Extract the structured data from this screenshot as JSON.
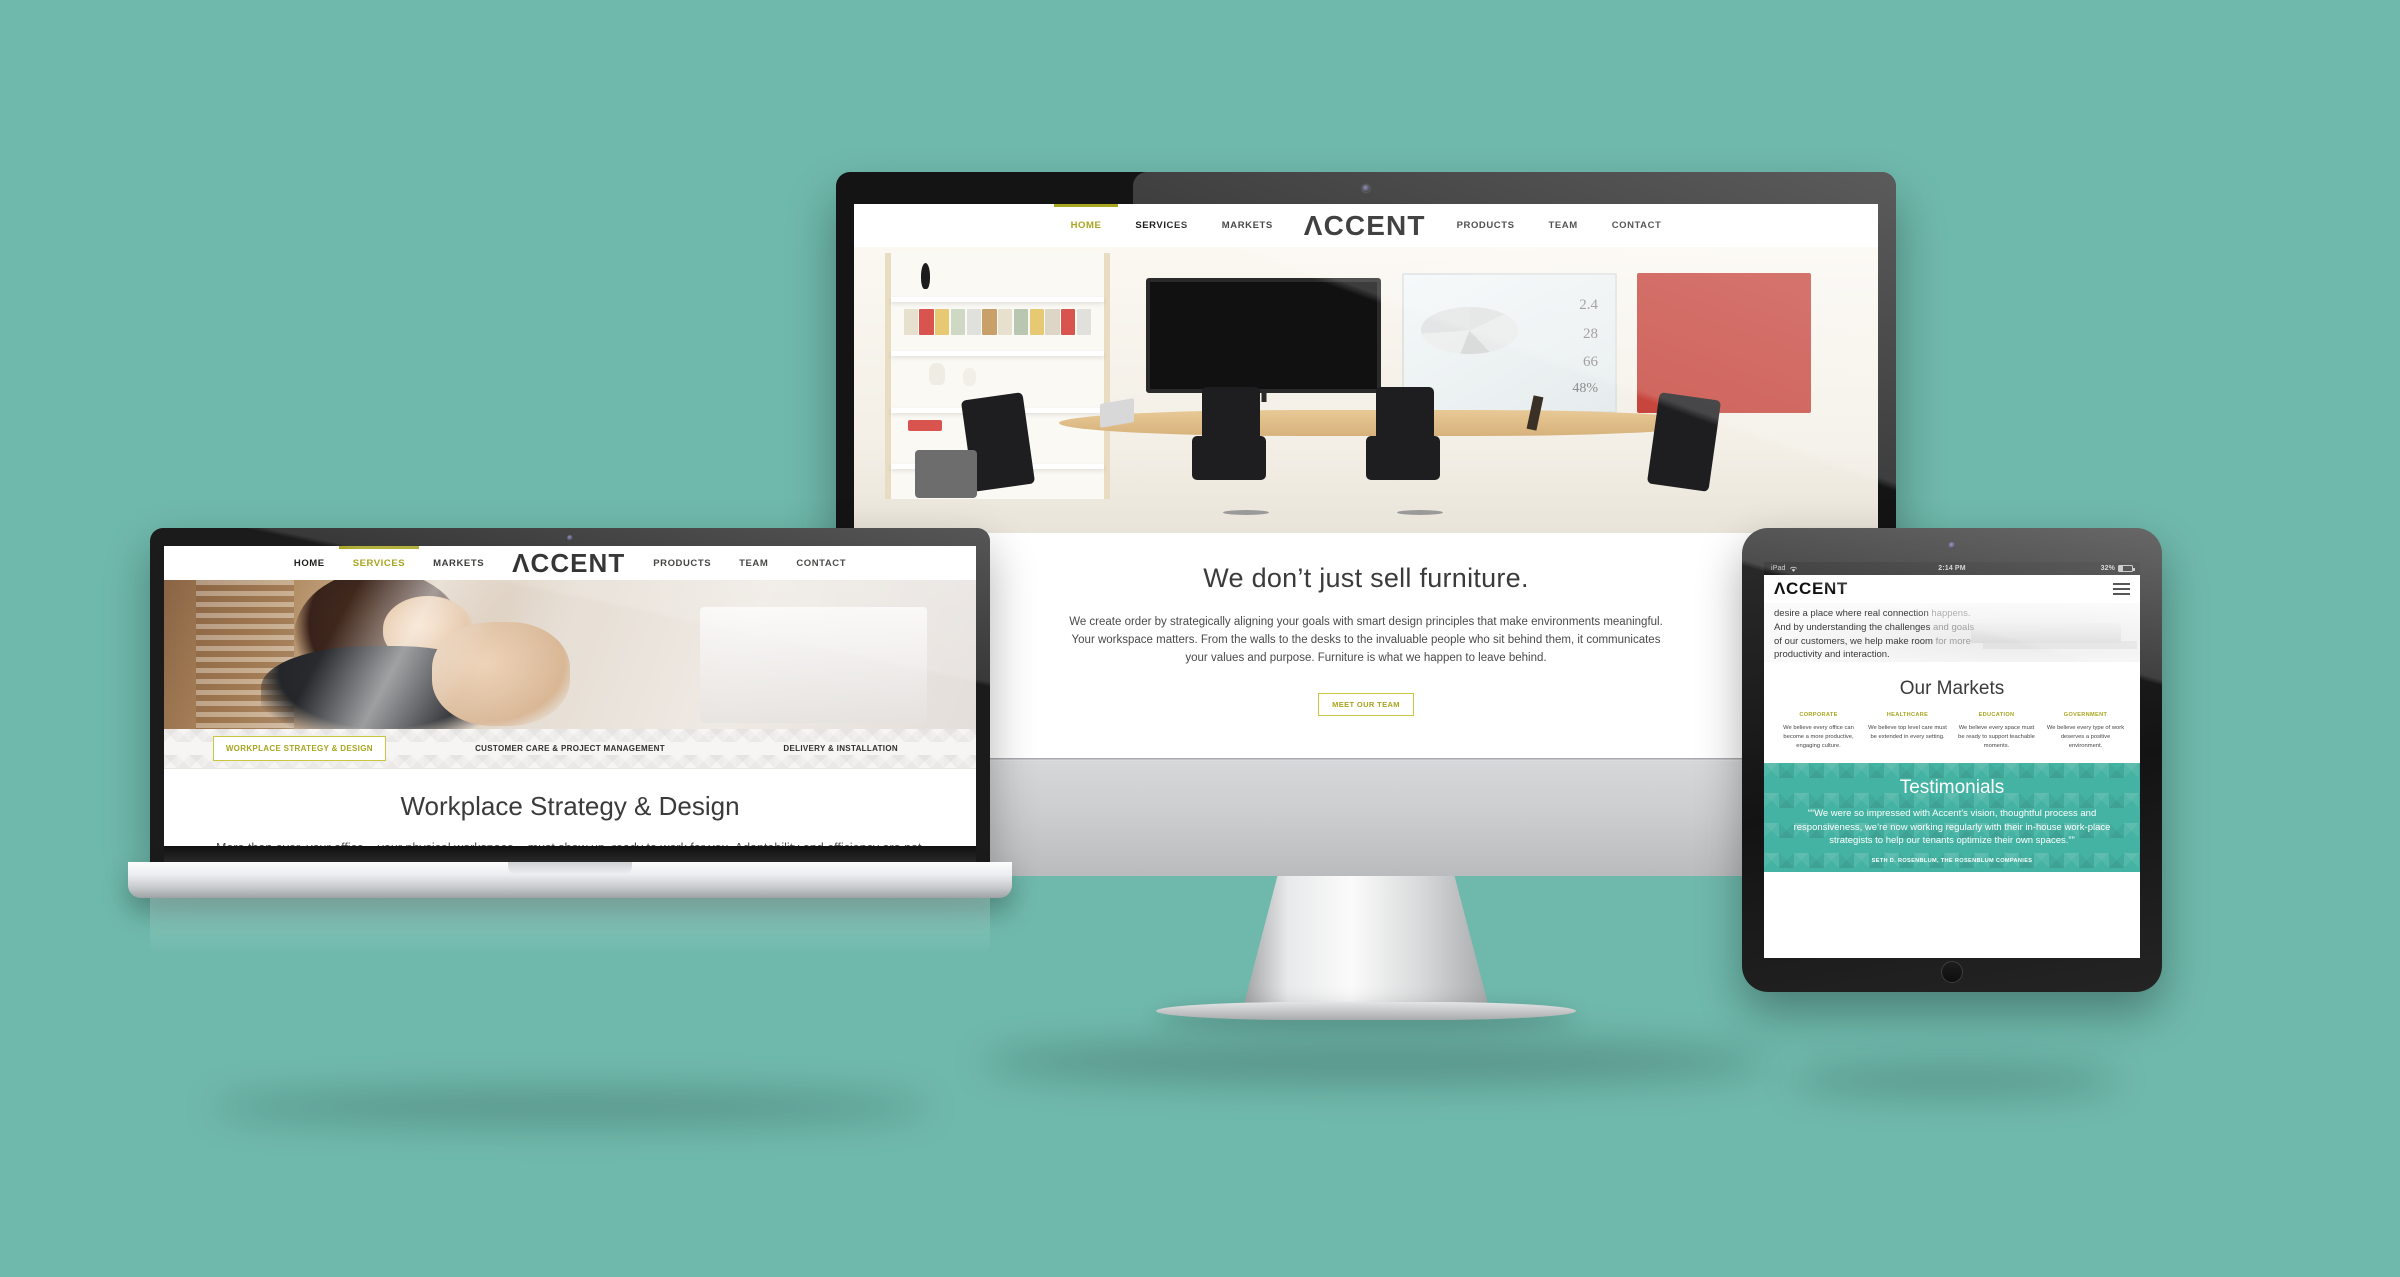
{
  "background_color": "#6fb9ac",
  "brand": {
    "name": "ACCENT",
    "logo_a": "Λ",
    "logo_rest": "CCENT",
    "accent_color": "#a8a520",
    "teal_color": "#45b3a3"
  },
  "nav": {
    "left_items": [
      {
        "label": "HOME",
        "active_desktop": true
      },
      {
        "label": "SERVICES",
        "active_laptop": true
      },
      {
        "label": "MARKETS"
      }
    ],
    "right_items": [
      {
        "label": "PRODUCTS"
      },
      {
        "label": "TEAM"
      },
      {
        "label": "CONTACT"
      }
    ]
  },
  "desktop": {
    "device": "imac",
    "nav_active": "HOME",
    "hero_alt": "conference-room-photo",
    "whiteboard_values": [
      "2.4",
      "28",
      "66",
      "48%"
    ],
    "heading": "We don’t just sell furniture.",
    "paragraph": "We create order by strategically aligning your goals with smart design principles that make environments meaningful. Your workspace matters. From the walls to the desks to the invaluable people who sit behind them, it communicates your values and purpose. Furniture is what we happen to leave behind.",
    "cta_label": "MEET OUR TEAM"
  },
  "laptop": {
    "device": "macbook-pro",
    "nav_active": "SERVICES",
    "hero_alt": "woman-at-desk-photo",
    "tabs": [
      {
        "label": "WORKPLACE STRATEGY & DESIGN",
        "active": true
      },
      {
        "label": "CUSTOMER CARE & PROJECT MANAGEMENT",
        "active": false
      },
      {
        "label": "DELIVERY & INSTALLATION",
        "active": false
      }
    ],
    "heading": "Workplace Strategy & Design",
    "paragraph": "More than ever, your office – your physical workspace – must show up, ready to work for you. Adaptability and efficiency are not limited to just describing your team. Today’s office"
  },
  "tablet": {
    "device": "ipad",
    "status_bar": {
      "carrier": "iPad",
      "wifi_icon": "wifi-icon",
      "time": "2:14 PM",
      "battery_percent": "32%"
    },
    "menu_icon": "hamburger-menu-icon",
    "intro_strong": "desire a place where real connection",
    "intro_fade_1": " happens.",
    "intro_line2_strong": "And by understanding the challenges",
    "intro_line2_fade": " and goals",
    "intro_line3_strong": "of our customers, we help make room",
    "intro_line3_fade": " for more",
    "intro_line4": "productivity and interaction.",
    "markets_heading": "Our Markets",
    "markets": [
      {
        "title": "CORPORATE",
        "text": "We believe every office can become a more productive, engaging culture."
      },
      {
        "title": "HEALTHCARE",
        "text": "We believe top level care must be extended in every setting."
      },
      {
        "title": "EDUCATION",
        "text": "We believe every space must be ready to support teachable moments."
      },
      {
        "title": "GOVERNMENT",
        "text": "We believe every type of work deserves a positive environment."
      }
    ],
    "testimonials_heading": "Testimonials",
    "testimonial_quote": "“We were so impressed with Accent’s vision, thoughtful process and responsiveness, we’re now working regularly with their in-house work-place strategists to help our tenants optimize their own spaces.”",
    "testimonial_author": "SETH D. ROSENBLUM, THE ROSENBLUM COMPANIES"
  }
}
